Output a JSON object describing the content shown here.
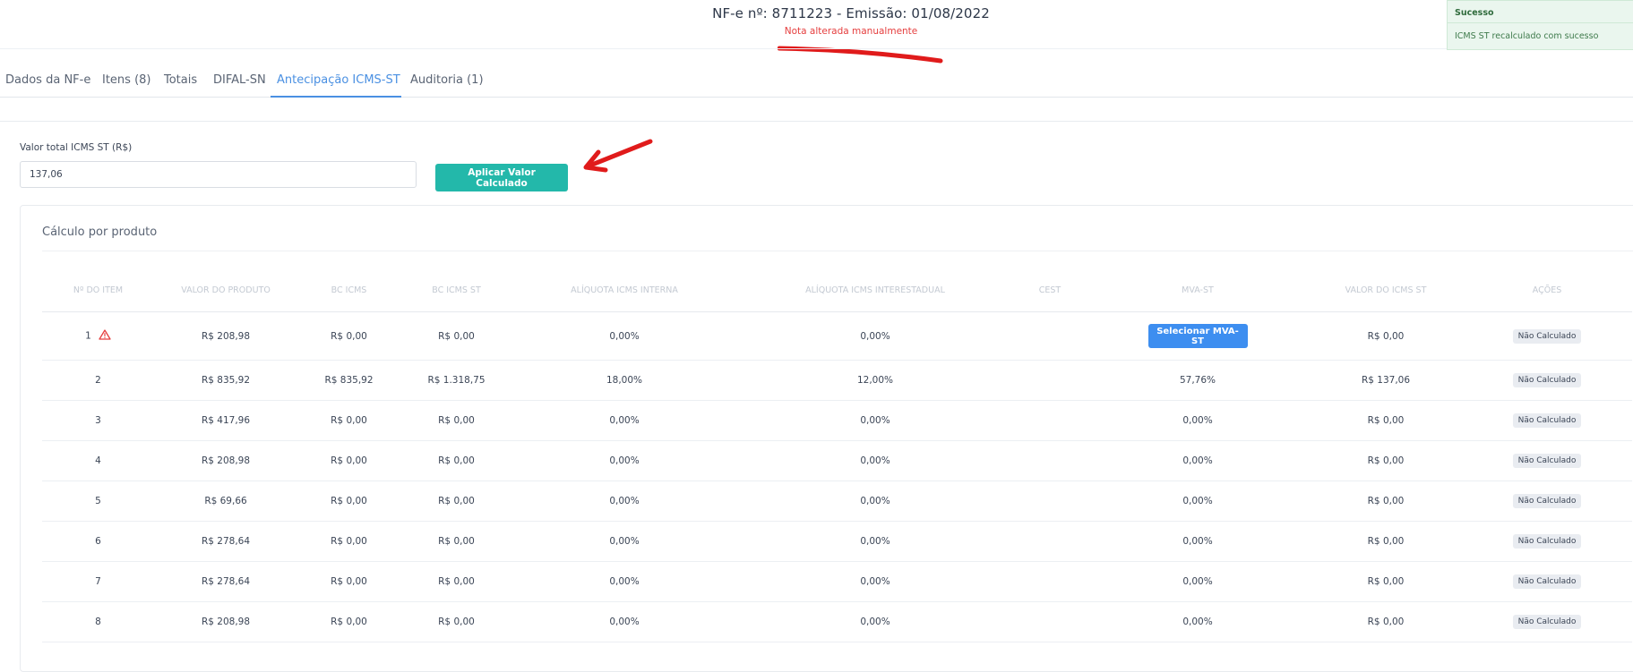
{
  "header": {
    "title": "NF-e nº: 8711223 - Emissão: 01/08/2022",
    "subtitle": "Nota alterada manualmente"
  },
  "tabs": [
    {
      "label": "Dados da NF-e",
      "active": false
    },
    {
      "label": "Itens (8)",
      "active": false
    },
    {
      "label": "Totais",
      "active": false
    },
    {
      "label": "DIFAL-SN",
      "active": false
    },
    {
      "label": "Antecipação ICMS-ST",
      "active": true
    },
    {
      "label": "Auditoria (1)",
      "active": false
    }
  ],
  "form": {
    "label": "Valor total ICMS ST (R$)",
    "value": "137,06",
    "apply_button": "Aplicar Valor Calculado"
  },
  "card": {
    "title": "Cálculo por produto",
    "columns": [
      "Nº DO ITEM",
      "VALOR DO PRODUTO",
      "BC ICMS",
      "BC ICMS ST",
      "ALÍQUOTA ICMS INTERNA",
      "ALÍQUOTA ICMS INTERESTADUAL",
      "CEST",
      "MVA-ST",
      "VALOR DO ICMS ST",
      "AÇÕES"
    ],
    "rows": [
      {
        "item": "1",
        "valor_produto": "R$ 208,98",
        "bc_icms": "R$ 0,00",
        "bc_icms_st": "R$ 0,00",
        "aliq_interna": "0,00%",
        "aliq_interestadual": "0,00%",
        "cest": "",
        "mva_st": "",
        "mva_button": "Selecionar MVA-ST",
        "valor_icms_st": "R$ 0,00",
        "acao": "Não Calculado",
        "warning": true
      },
      {
        "item": "2",
        "valor_produto": "R$ 835,92",
        "bc_icms": "R$ 835,92",
        "bc_icms_st": "R$ 1.318,75",
        "aliq_interna": "18,00%",
        "aliq_interestadual": "12,00%",
        "cest": "",
        "mva_st": "57,76%",
        "valor_icms_st": "R$ 137,06",
        "acao": "Não Calculado"
      },
      {
        "item": "3",
        "valor_produto": "R$ 417,96",
        "bc_icms": "R$ 0,00",
        "bc_icms_st": "R$ 0,00",
        "aliq_interna": "0,00%",
        "aliq_interestadual": "0,00%",
        "cest": "",
        "mva_st": "0,00%",
        "valor_icms_st": "R$ 0,00",
        "acao": "Não Calculado"
      },
      {
        "item": "4",
        "valor_produto": "R$ 208,98",
        "bc_icms": "R$ 0,00",
        "bc_icms_st": "R$ 0,00",
        "aliq_interna": "0,00%",
        "aliq_interestadual": "0,00%",
        "cest": "",
        "mva_st": "0,00%",
        "valor_icms_st": "R$ 0,00",
        "acao": "Não Calculado"
      },
      {
        "item": "5",
        "valor_produto": "R$ 69,66",
        "bc_icms": "R$ 0,00",
        "bc_icms_st": "R$ 0,00",
        "aliq_interna": "0,00%",
        "aliq_interestadual": "0,00%",
        "cest": "",
        "mva_st": "0,00%",
        "valor_icms_st": "R$ 0,00",
        "acao": "Não Calculado"
      },
      {
        "item": "6",
        "valor_produto": "R$ 278,64",
        "bc_icms": "R$ 0,00",
        "bc_icms_st": "R$ 0,00",
        "aliq_interna": "0,00%",
        "aliq_interestadual": "0,00%",
        "cest": "",
        "mva_st": "0,00%",
        "valor_icms_st": "R$ 0,00",
        "acao": "Não Calculado"
      },
      {
        "item": "7",
        "valor_produto": "R$ 278,64",
        "bc_icms": "R$ 0,00",
        "bc_icms_st": "R$ 0,00",
        "aliq_interna": "0,00%",
        "aliq_interestadual": "0,00%",
        "cest": "",
        "mva_st": "0,00%",
        "valor_icms_st": "R$ 0,00",
        "acao": "Não Calculado"
      },
      {
        "item": "8",
        "valor_produto": "R$ 208,98",
        "bc_icms": "R$ 0,00",
        "bc_icms_st": "R$ 0,00",
        "aliq_interna": "0,00%",
        "aliq_interestadual": "0,00%",
        "cest": "",
        "mva_st": "0,00%",
        "valor_icms_st": "R$ 0,00",
        "acao": "Não Calculado"
      }
    ]
  },
  "toast": {
    "title": "Sucesso",
    "message": "ICMS ST recalculado com sucesso"
  },
  "icons": {
    "warning": "warning-triangle-icon",
    "annotation_arrow": "red-arrow-annotation",
    "annotation_underline": "red-underline-annotation"
  },
  "colors": {
    "accent": "#4a90e2",
    "apply_button": "#23b8aa",
    "mva_button": "#3d8ef0",
    "warning": "#e53e3e",
    "toast_bg": "#eaf6ee"
  }
}
